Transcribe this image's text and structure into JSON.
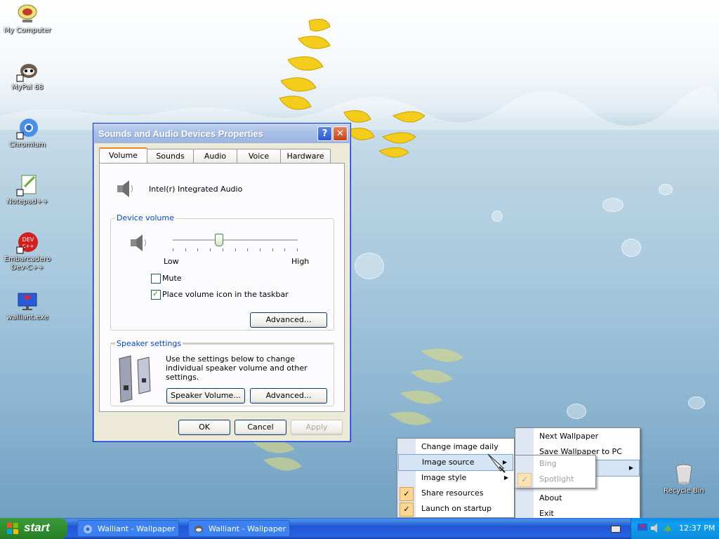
{
  "desktop": {
    "icons": [
      {
        "label": "My Computer",
        "icon": "my-computer-icon"
      },
      {
        "label": "MyPal 68",
        "icon": "mypal-icon"
      },
      {
        "label": "Chromium",
        "icon": "chromium-icon"
      },
      {
        "label": "Notepad++",
        "icon": "notepad-plus-plus-icon"
      },
      {
        "label": "Embarcadero Dev-C++",
        "icon": "devcpp-icon"
      },
      {
        "label": "walliant.exe",
        "icon": "walliant-icon"
      },
      {
        "label": "Recycle Bin",
        "icon": "recycle-bin-icon"
      }
    ]
  },
  "dialog": {
    "title": "Sounds and Audio Devices Properties",
    "help_glyph": "?",
    "close_glyph": "✕",
    "tabs": [
      "Volume",
      "Sounds",
      "Audio",
      "Voice",
      "Hardware"
    ],
    "active_tab": "Volume",
    "device_name": "Intel(r) Integrated Audio",
    "device_volume": {
      "group_title": "Device volume",
      "low_label": "Low",
      "high_label": "High",
      "level": 0.36,
      "mute_label": "Mute",
      "mute_checked": false,
      "taskbar_icon_label": "Place volume icon in the taskbar",
      "taskbar_icon_checked": true,
      "advanced_label": "Advanced..."
    },
    "speaker_settings": {
      "group_title": "Speaker settings",
      "description": "Use the settings below to change individual speaker volume and other settings.",
      "speaker_volume_label": "Speaker Volume...",
      "advanced_label": "Advanced..."
    },
    "buttons": {
      "ok": "OK",
      "cancel": "Cancel",
      "apply": "Apply"
    }
  },
  "tray_menu": {
    "items": [
      {
        "label": "Change image daily",
        "checked": false,
        "submenu": false
      },
      {
        "label": "Image source",
        "checked": false,
        "submenu": true,
        "highlighted": true
      },
      {
        "label": "Image style",
        "checked": false,
        "submenu": true
      },
      {
        "label": "Share resources",
        "checked": true,
        "submenu": false
      },
      {
        "label": "Launch on startup",
        "checked": true,
        "submenu": false
      }
    ]
  },
  "main_menu": {
    "items": [
      {
        "label": "Next Wallpaper"
      },
      {
        "label": "Save Wallpaper to PC"
      },
      {
        "label": ""
      },
      {
        "label": "About"
      },
      {
        "label": "Exit"
      }
    ]
  },
  "source_submenu": {
    "items": [
      {
        "label": "Bing",
        "checked": false,
        "disabled": true
      },
      {
        "label": "Spotlight",
        "checked": true,
        "disabled": true
      }
    ]
  },
  "taskbar": {
    "start_label": "start",
    "items": [
      {
        "label": "Walliant - Wallpaper ...",
        "icon": "chromium-icon"
      },
      {
        "label": "Walliant - Wallpaper ...",
        "icon": "mypal-icon"
      }
    ],
    "clock": "12:37 PM"
  },
  "colors": {
    "xp_blue": "#0831d9",
    "taskbar_blue": "#2157d7",
    "start_green": "#2f8f2f",
    "menu_highlight": "#d6e5f5",
    "check_bg": "#fdd78f"
  }
}
